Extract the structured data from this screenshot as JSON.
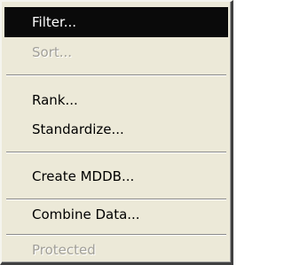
{
  "menu": {
    "items": [
      {
        "id": "filter",
        "label": "Filter...",
        "state": "selected"
      },
      {
        "id": "sort",
        "label": "Sort...",
        "state": "disabled"
      },
      {
        "id": "rank",
        "label": "Rank...",
        "state": "enabled"
      },
      {
        "id": "standardize",
        "label": "Standardize...",
        "state": "enabled"
      },
      {
        "id": "create-mddb",
        "label": "Create MDDB...",
        "state": "enabled"
      },
      {
        "id": "combine-data",
        "label": "Combine Data...",
        "state": "enabled"
      },
      {
        "id": "protected",
        "label": "Protected",
        "state": "disabled"
      }
    ]
  },
  "colors": {
    "menu_background": "#ece9d8",
    "selection_background": "#0a0a0a",
    "selection_text": "#ffffff",
    "disabled_text": "#a19f98"
  }
}
